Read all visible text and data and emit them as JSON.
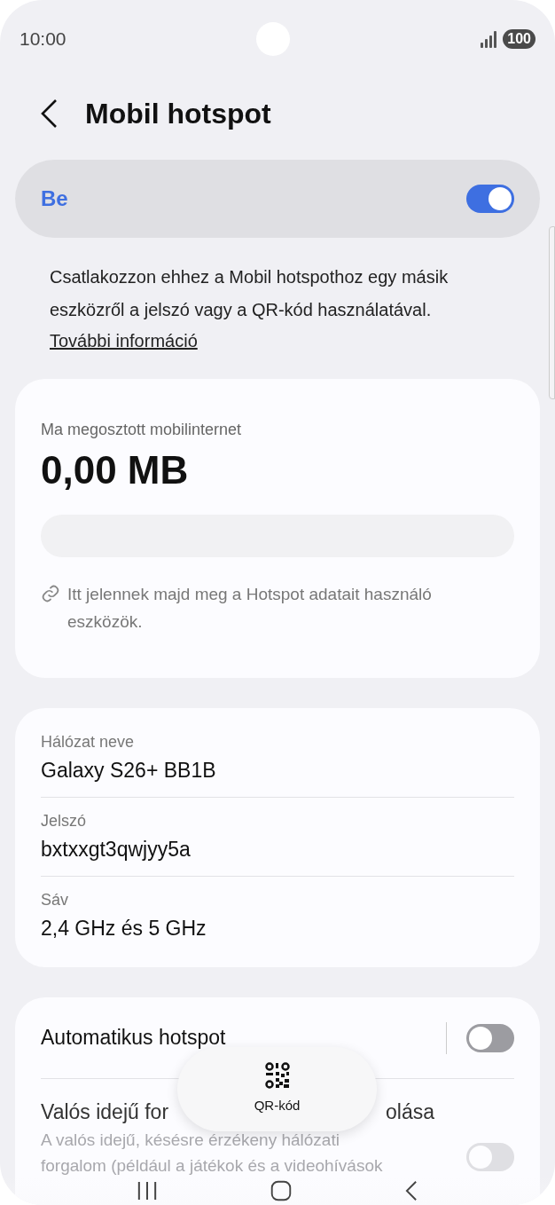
{
  "status_bar": {
    "time": "10:00",
    "battery": "100"
  },
  "header": {
    "title": "Mobil hotspot"
  },
  "master_switch": {
    "label": "Be",
    "on": true
  },
  "description": {
    "text": "Csatlakozzon ehhez a Mobil hotspothoz egy másik eszközről a jelszó vagy a QR-kód használatával.",
    "link": "További információ"
  },
  "usage": {
    "label": "Ma megosztott mobilinternet",
    "amount": "0,00 MB",
    "note": "Itt jelennek majd meg a Hotspot adatait használó eszközök."
  },
  "network": [
    {
      "label": "Hálózat neve",
      "value": "Galaxy S26+ BB1B"
    },
    {
      "label": "Jelszó",
      "value": "bxtxxgt3qwjyy5a"
    },
    {
      "label": "Sáv",
      "value": "2,4 GHz és 5 GHz"
    }
  ],
  "settings": [
    {
      "kind": "plain",
      "title": "Automatikus hotspot",
      "on": false
    },
    {
      "kind": "covered",
      "title_start": "Valós idejű for",
      "title_end": "olása",
      "description_lines": [
        "A valós idejű, késésre érzékeny hálózati",
        "forgalom (például a játékok és a videohívások"
      ],
      "on": false
    }
  ],
  "floating_button": {
    "label": "QR-kód"
  }
}
